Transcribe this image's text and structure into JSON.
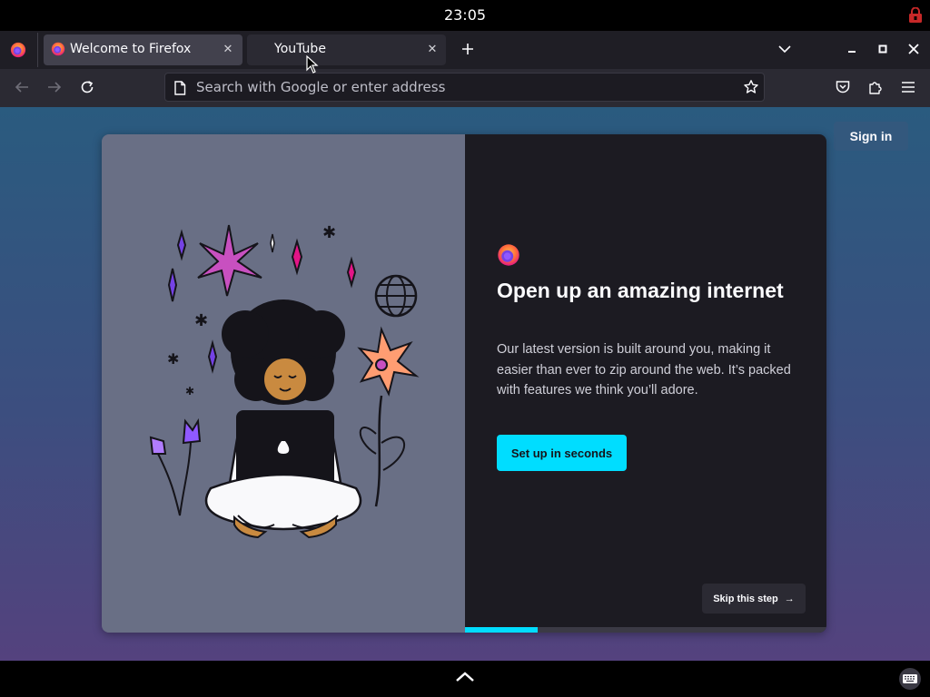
{
  "system": {
    "clock": "23:05"
  },
  "tabs": [
    {
      "title": "Welcome to Firefox",
      "active": true
    },
    {
      "title": "YouTube",
      "active": false
    }
  ],
  "toolbar": {
    "url_placeholder": "Search with Google or enter address"
  },
  "page": {
    "sign_in_label": "Sign in",
    "headline": "Open up an amazing internet",
    "body": "Our latest version is built around you, making it easier than ever to zip around the web. It’s packed with features we think you’ll adore.",
    "cta_label": "Set up in seconds",
    "skip_label": "Skip this step",
    "progress": 0.2
  },
  "colors": {
    "accent": "#00ddff",
    "card_right": "#1c1b22",
    "card_left": "#696f85",
    "sign_in_bg": "#33587d"
  },
  "icons": [
    "firefox-icon",
    "lock-icon",
    "close-icon",
    "plus-icon",
    "chevron-down-icon",
    "minimize-icon",
    "maximize-icon",
    "back-icon",
    "forward-icon",
    "reload-icon",
    "page-icon",
    "star-icon",
    "pocket-icon",
    "extensions-icon",
    "menu-icon",
    "arrow-right-icon",
    "chevron-up-icon",
    "keyboard-icon",
    "mouse-cursor-icon"
  ]
}
